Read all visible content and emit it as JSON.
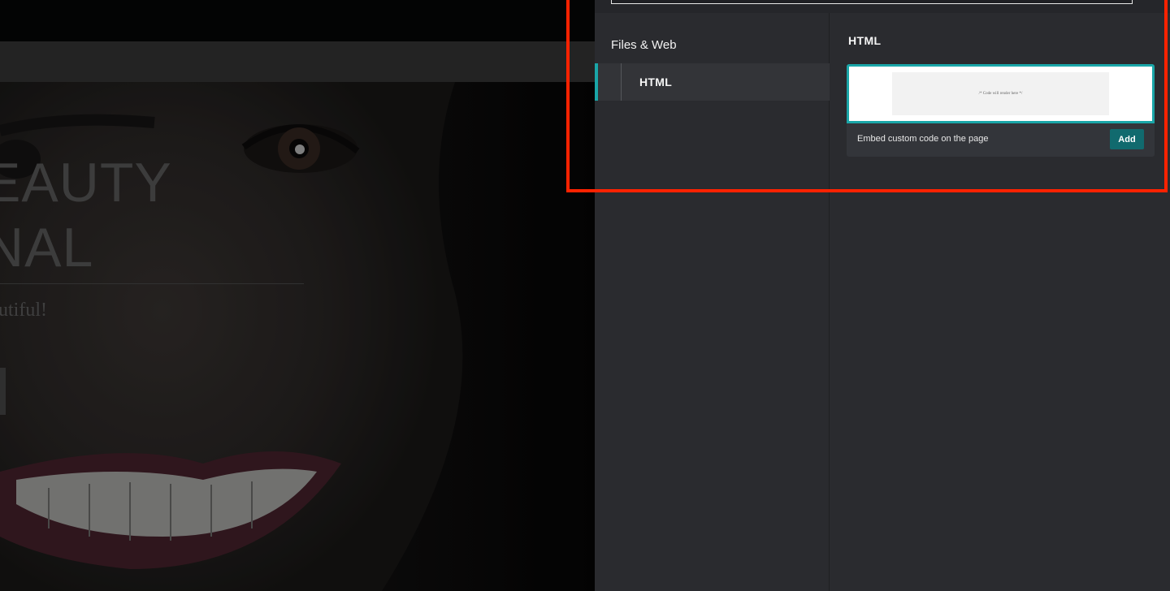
{
  "site_preview": {
    "hero_title_line1": "EAUTY",
    "hero_title_line2": "NAL",
    "hero_subtitle": "utiful!"
  },
  "panel": {
    "search": {
      "value": "",
      "placeholder": ""
    },
    "category_group": "Files & Web",
    "categories": [
      {
        "label": "HTML",
        "selected": true
      }
    ],
    "section_heading": "HTML",
    "cards": [
      {
        "preview_code": "/* Code will render here */",
        "description": "Embed custom code on the page",
        "add_label": "Add"
      }
    ]
  },
  "colors": {
    "accent": "#1aa6a8",
    "add_button": "#116a6e",
    "panel_bg": "#2a2b2f",
    "highlight": "#ff2200"
  }
}
